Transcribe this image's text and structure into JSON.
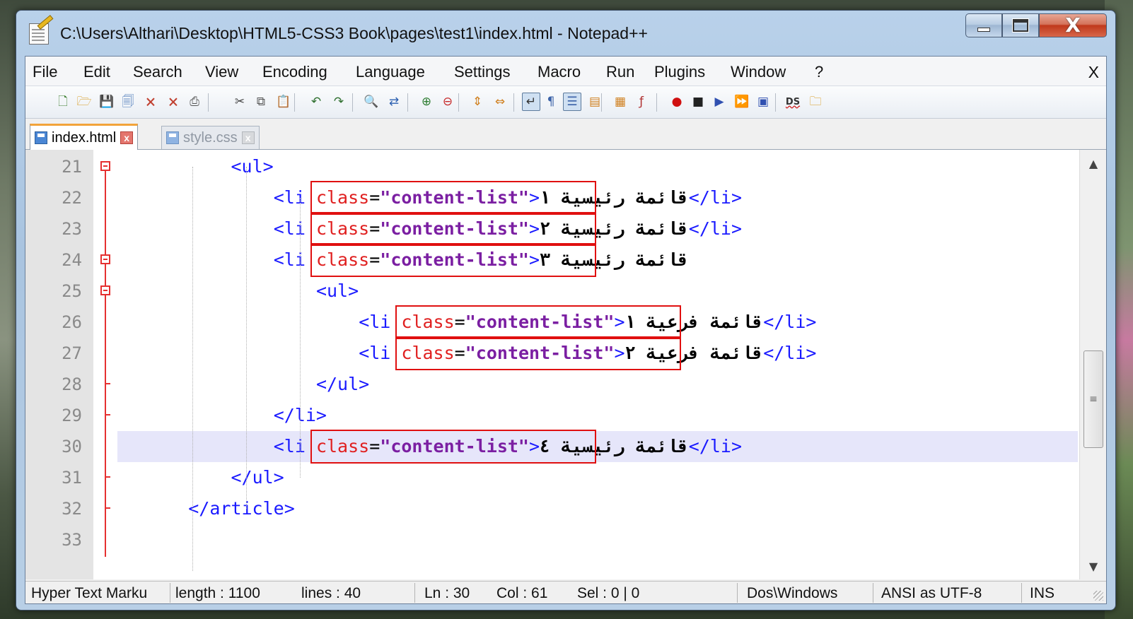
{
  "window": {
    "title": "C:\\Users\\Althari\\Desktop\\HTML5-CSS3 Book\\pages\\test1\\index.html - Notepad++",
    "minimize": "minimize",
    "maximize": "maximize",
    "close": "X"
  },
  "menu": {
    "items": [
      "File",
      "Edit",
      "Search",
      "View",
      "Encoding",
      "Language",
      "Settings",
      "Macro",
      "Run",
      "Plugins",
      "Window",
      "?"
    ],
    "close": "X"
  },
  "toolbar": {
    "icons": [
      "new-file-icon",
      "open-file-icon",
      "save-icon",
      "save-all-icon",
      "close-icon",
      "close-all-icon",
      "print-icon",
      "cut-icon",
      "copy-icon",
      "paste-icon",
      "undo-icon",
      "redo-icon",
      "find-icon",
      "replace-icon",
      "zoom-in-icon",
      "zoom-out-icon",
      "sync-vertical-icon",
      "sync-horizontal-icon",
      "word-wrap-icon",
      "show-all-chars-icon",
      "indent-guide-icon",
      "user-defined-language-icon",
      "document-map-icon",
      "function-list-icon",
      "record-macro-icon",
      "stop-record-icon",
      "play-macro-icon",
      "run-macro-multiple-icon",
      "save-macro-icon",
      "spell-check-icon",
      "plugin-icon"
    ]
  },
  "tabs": [
    {
      "label": "index.html",
      "close": "x"
    },
    {
      "label": "style.css",
      "close": "x"
    }
  ],
  "editor": {
    "lines": [
      {
        "num": "21",
        "indent": "        ",
        "tokens": [
          {
            "t": "tag",
            "v": "<ul>"
          }
        ]
      },
      {
        "num": "22",
        "indent": "            ",
        "tokens": [
          {
            "t": "tag",
            "v": "<li "
          },
          {
            "t": "attr",
            "v": "class"
          },
          {
            "t": "eq",
            "v": "="
          },
          {
            "t": "val",
            "v": "\"content-list\""
          },
          {
            "t": "tag",
            "v": ">"
          },
          {
            "t": "txt",
            "v": "قائمة رئيسية ١"
          },
          {
            "t": "tag",
            "v": "</li>"
          }
        ]
      },
      {
        "num": "23",
        "indent": "            ",
        "tokens": [
          {
            "t": "tag",
            "v": "<li "
          },
          {
            "t": "attr",
            "v": "class"
          },
          {
            "t": "eq",
            "v": "="
          },
          {
            "t": "val",
            "v": "\"content-list\""
          },
          {
            "t": "tag",
            "v": ">"
          },
          {
            "t": "txt",
            "v": "قائمة رئيسية ٢"
          },
          {
            "t": "tag",
            "v": "</li>"
          }
        ]
      },
      {
        "num": "24",
        "indent": "            ",
        "tokens": [
          {
            "t": "tag",
            "v": "<li "
          },
          {
            "t": "attr",
            "v": "class"
          },
          {
            "t": "eq",
            "v": "="
          },
          {
            "t": "val",
            "v": "\"content-list\""
          },
          {
            "t": "tag",
            "v": ">"
          },
          {
            "t": "txt",
            "v": "قائمة رئيسية ٣"
          }
        ]
      },
      {
        "num": "25",
        "indent": "                ",
        "tokens": [
          {
            "t": "tag",
            "v": "<ul>"
          }
        ]
      },
      {
        "num": "26",
        "indent": "                    ",
        "tokens": [
          {
            "t": "tag",
            "v": "<li "
          },
          {
            "t": "attr",
            "v": "class"
          },
          {
            "t": "eq",
            "v": "="
          },
          {
            "t": "val",
            "v": "\"content-list\""
          },
          {
            "t": "tag",
            "v": ">"
          },
          {
            "t": "txt",
            "v": "قائمة فرعية ١"
          },
          {
            "t": "tag",
            "v": "</li>"
          }
        ]
      },
      {
        "num": "27",
        "indent": "                    ",
        "tokens": [
          {
            "t": "tag",
            "v": "<li "
          },
          {
            "t": "attr",
            "v": "class"
          },
          {
            "t": "eq",
            "v": "="
          },
          {
            "t": "val",
            "v": "\"content-list\""
          },
          {
            "t": "tag",
            "v": ">"
          },
          {
            "t": "txt",
            "v": "قائمة فرعية ٢"
          },
          {
            "t": "tag",
            "v": "</li>"
          }
        ]
      },
      {
        "num": "28",
        "indent": "                ",
        "tokens": [
          {
            "t": "tag",
            "v": "</ul>"
          }
        ]
      },
      {
        "num": "29",
        "indent": "            ",
        "tokens": [
          {
            "t": "tag",
            "v": "</li>"
          }
        ]
      },
      {
        "num": "30",
        "indent": "            ",
        "tokens": [
          {
            "t": "tag",
            "v": "<li "
          },
          {
            "t": "attr",
            "v": "class"
          },
          {
            "t": "eq",
            "v": "="
          },
          {
            "t": "val",
            "v": "\"content-list\""
          },
          {
            "t": "tag",
            "v": ">"
          },
          {
            "t": "txt",
            "v": "قائمة رئيسية ٤"
          },
          {
            "t": "tag",
            "v": "</li>"
          }
        ]
      },
      {
        "num": "31",
        "indent": "        ",
        "tokens": [
          {
            "t": "tag",
            "v": "</ul>"
          }
        ]
      },
      {
        "num": "32",
        "indent": "    ",
        "tokens": [
          {
            "t": "tag",
            "v": "</article>"
          }
        ]
      },
      {
        "num": "33",
        "indent": "",
        "tokens": []
      }
    ],
    "current_line": "30"
  },
  "status": {
    "language": "Hyper Text Marku",
    "length": "length : 1100",
    "lines": "lines : 40",
    "ln": "Ln : 30",
    "col": "Col : 61",
    "sel": "Sel : 0 | 0",
    "eol": "Dos\\Windows",
    "encoding": "ANSI as UTF-8",
    "mode": "INS"
  },
  "colors": {
    "tag": "#1a1aff",
    "attribute": "#e02020",
    "value": "#7b1fa2",
    "highlight_box": "#e01010",
    "current_line": "#e6e6fa"
  }
}
